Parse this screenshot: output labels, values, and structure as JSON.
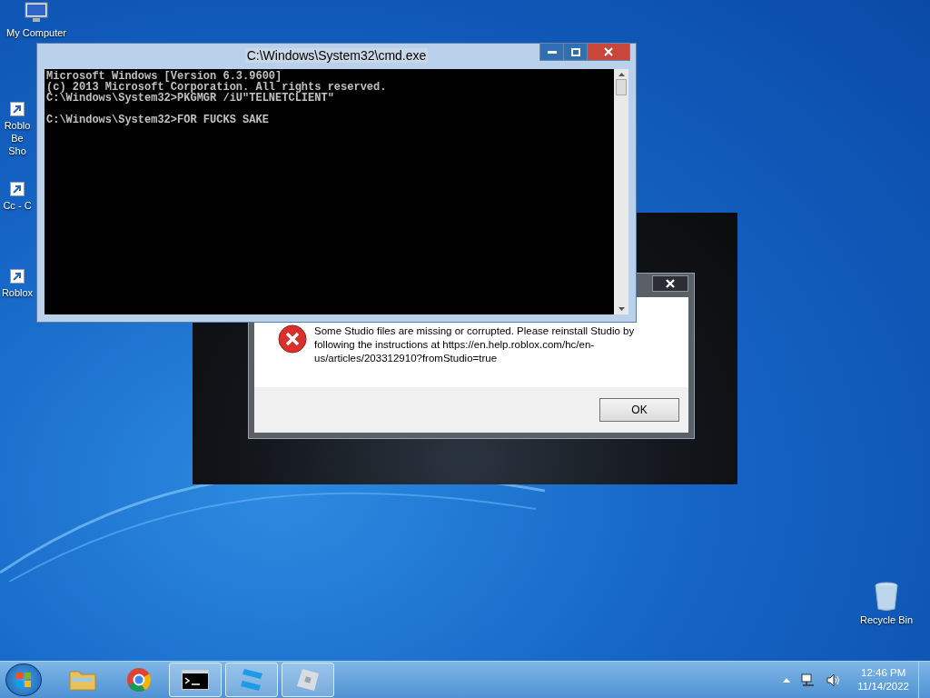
{
  "desktop_icons": [
    {
      "kind": "computer",
      "lines": [
        "My Computer"
      ]
    },
    {
      "kind": "shortcut",
      "lines": [
        "Roblo",
        "Be",
        "Sho"
      ]
    },
    {
      "kind": "shortcut",
      "lines": [
        "Cc - C"
      ]
    },
    {
      "kind": "shortcut",
      "lines": [
        "Roblox"
      ]
    },
    {
      "kind": "recycle",
      "lines": [
        "Recycle Bin"
      ]
    }
  ],
  "console_window": {
    "title": "C:\\Windows\\System32\\cmd.exe",
    "blocks": [
      [
        "Microsoft Windows [Version 6.3.9600]",
        "(c) 2013 Microsoft Corporation. All rights reserved.",
        "C:\\Windows\\System32>PKGMGR /iU\"TELNETCLIENT\""
      ],
      [
        "C:\\Windows\\System32>FOR FUCKS SAKE"
      ]
    ]
  },
  "error_dialog": {
    "message": "Some Studio files are missing or corrupted. Please reinstall Studio by following the instructions at https://en.help.roblox.com/hc/en-us/articles/203312910?fromStudio=true",
    "buttons": [
      "OK"
    ]
  },
  "taskbar": {
    "items": [
      {
        "kind": "folder",
        "running": false
      },
      {
        "kind": "browser",
        "running": false
      },
      {
        "kind": "terminal",
        "running": true
      },
      {
        "kind": "studio",
        "running": true
      },
      {
        "kind": "roblox",
        "running": true
      }
    ],
    "clock": {
      "time": "12:46 PM",
      "date": "11/14/2022"
    }
  }
}
